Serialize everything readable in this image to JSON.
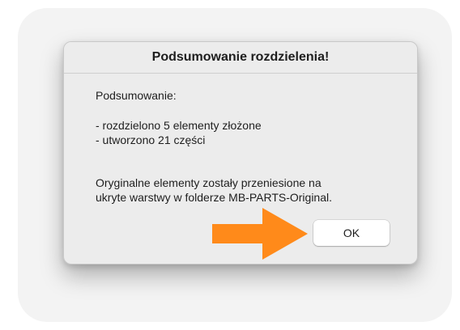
{
  "dialog": {
    "title": "Podsumowanie rozdzielenia!",
    "summary_heading": "Podsumowanie:",
    "summary_lines": [
      "- rozdzielono 5 elementy złożone",
      "- utworzono 21 części"
    ],
    "info_lines": [
      "Oryginalne elementy zostały przeniesione na",
      "ukryte warstwy w folderze MB-PARTS-Original."
    ],
    "ok_label": "OK"
  },
  "annotation": {
    "icon": "arrow-right-icon",
    "color": "#ff8a1a"
  }
}
